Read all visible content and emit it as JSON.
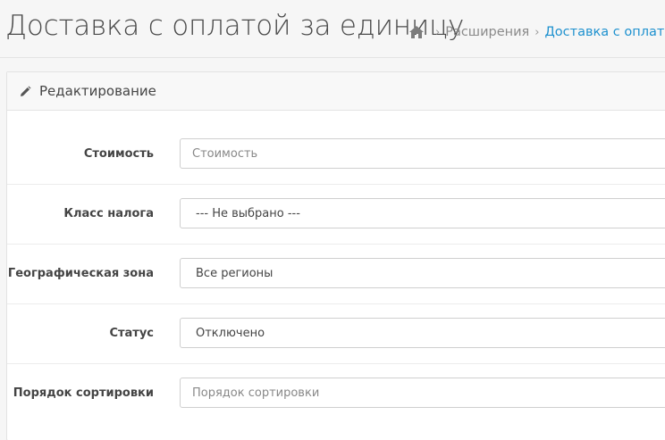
{
  "header": {
    "title": "Доставка с оплатой за единицу",
    "breadcrumb": {
      "home_icon": "home-icon",
      "items": [
        {
          "label": "Расширения"
        },
        {
          "label": "Доставка с оплатой за единицу"
        }
      ]
    }
  },
  "panel": {
    "icon": "pencil-icon",
    "title": "Редактирование"
  },
  "form": {
    "cost": {
      "label": "Стоимость",
      "placeholder": "Стоимость"
    },
    "tax_class": {
      "label": "Класс налога",
      "value": "--- Не выбрано ---"
    },
    "geo_zone": {
      "label": "Географическая зона",
      "value": "Все регионы"
    },
    "status": {
      "label": "Статус",
      "value": "Отключено"
    },
    "sort_order": {
      "label": "Порядок сортировки",
      "placeholder": "Порядок сортировки"
    }
  },
  "colors": {
    "link": "#1e91cf",
    "muted": "#8a8a8a",
    "border": "#cfcfcf"
  }
}
